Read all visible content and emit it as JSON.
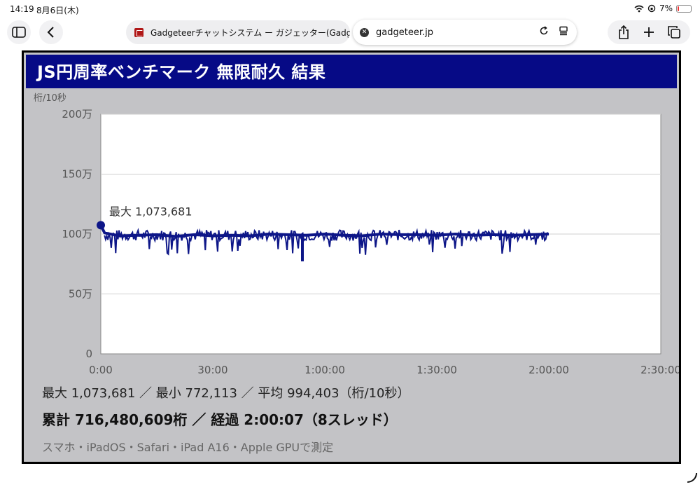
{
  "status_bar": {
    "time": "14:19",
    "date": "8月6日(木)",
    "battery": "7%"
  },
  "browser": {
    "tab_title": "Gadgeteerチャットシステム ー ガジェッター(Gadg",
    "url": "gadgeteer.jp"
  },
  "benchmark": {
    "title": "JS円周率ベンチマーク 無限耐久 結果",
    "unit_label": "桁/10秒",
    "max_annotation": "最大 1,073,681",
    "stats_line1": "最大 1,073,681 ／ 最小 772,113 ／ 平均 994,403（桁/10秒）",
    "stats_line2": "累計 716,480,609桁 ／ 経過 2:00:07（8スレッド）",
    "device_line": "スマホ・iPadOS・Safari・iPad A16・Apple GPUで測定"
  },
  "chart_data": {
    "type": "line",
    "title": "JS円周率ベンチマーク 無限耐久 結果",
    "ylabel": "桁/10秒",
    "xlim": [
      0,
      150
    ],
    "ylim": [
      0,
      2000000
    ],
    "x_ticks": [
      "0:00",
      "30:00",
      "1:00:00",
      "1:30:00",
      "2:00:00",
      "2:30:00"
    ],
    "y_ticks": [
      "0",
      "50万",
      "100万",
      "150万",
      "200万"
    ],
    "grid": true,
    "series": [
      {
        "name": "",
        "color": "#0d1688",
        "x": [
          0,
          1,
          5,
          10,
          15,
          20,
          25,
          30,
          35,
          40,
          45,
          50,
          55,
          60,
          65,
          70,
          75,
          80,
          85,
          90,
          95,
          100,
          105,
          110,
          115,
          120
        ],
        "y": [
          1073681,
          1010000,
          985000,
          990000,
          995000,
          980000,
          995000,
          985000,
          990000,
          985000,
          1000000,
          995000,
          990000,
          1000000,
          990000,
          985000,
          1000000,
          995000,
          995000,
          990000,
          1000000,
          990000,
          995000,
          990000,
          995000,
          1000000
        ]
      }
    ],
    "max": 1073681,
    "min": 772113,
    "avg": 994403
  }
}
